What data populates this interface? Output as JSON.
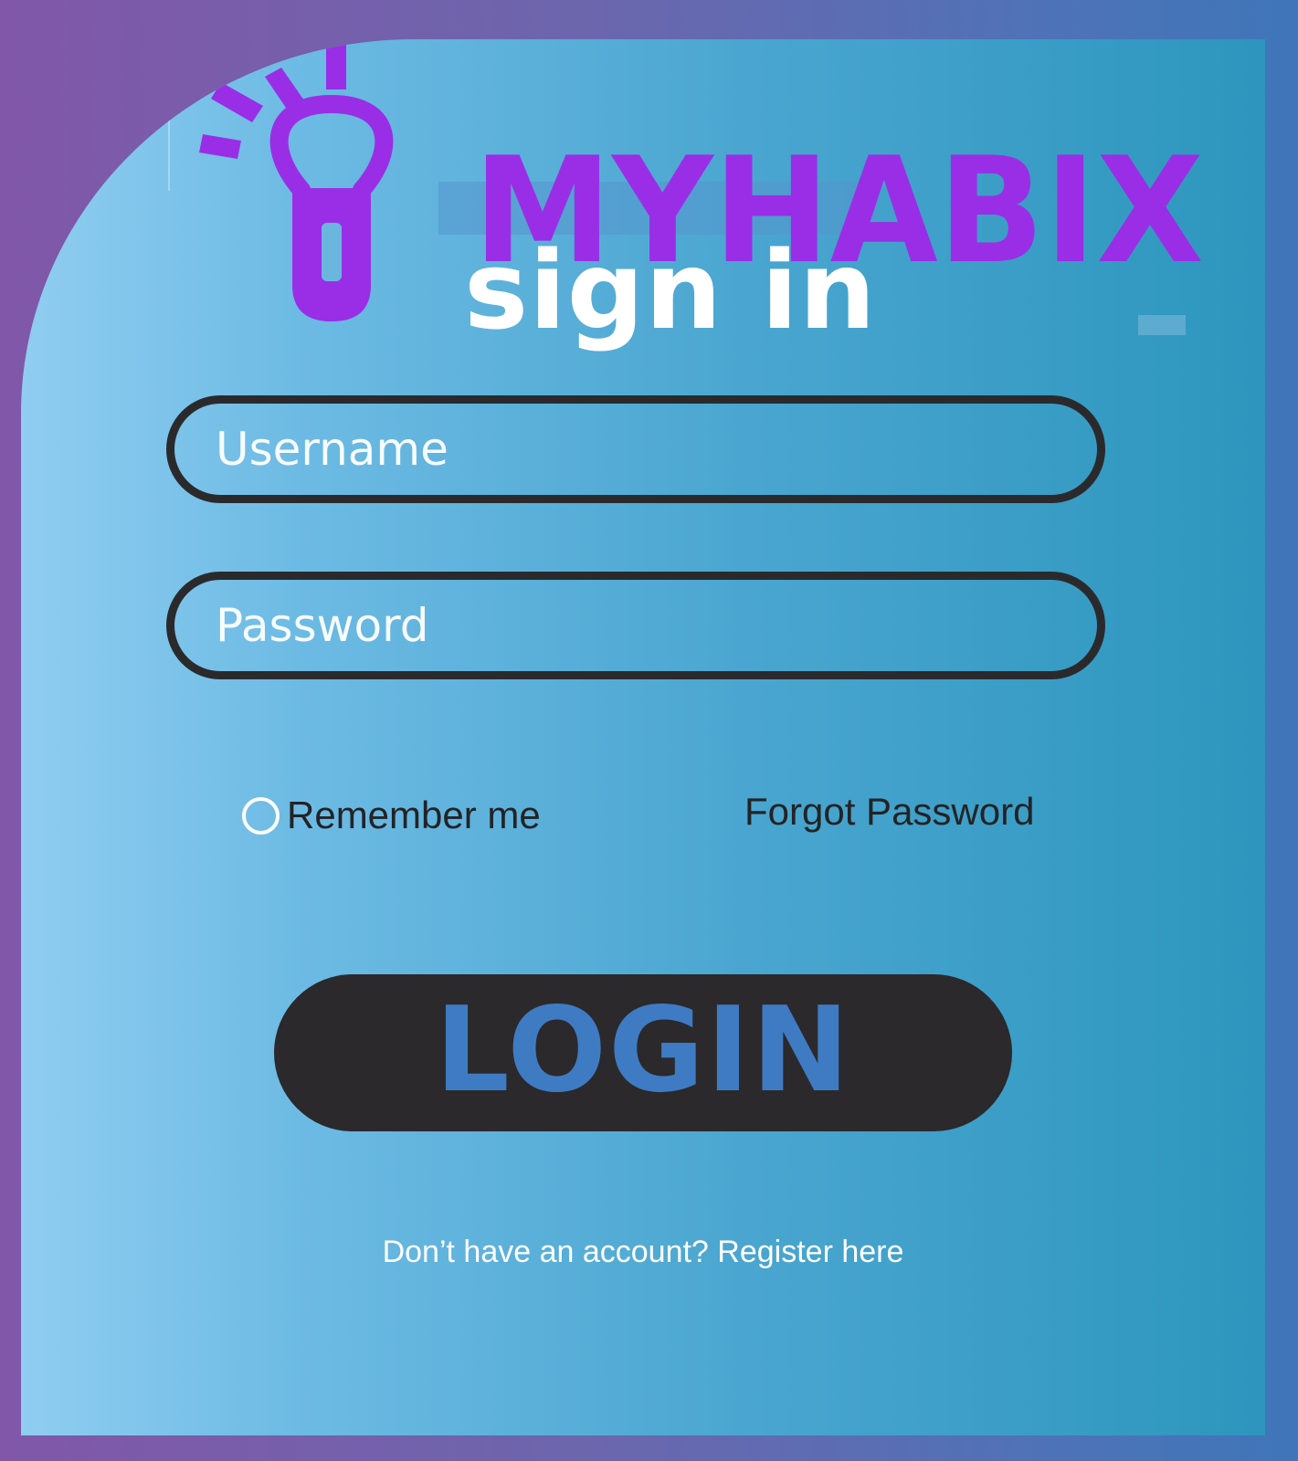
{
  "brand": {
    "name": "MYHABIX",
    "color": "#9a2ee6"
  },
  "heading": "sign in",
  "form": {
    "username_placeholder": "Username",
    "password_placeholder": "Password",
    "remember_label": "Remember me",
    "forgot_label": "Forgot Password",
    "login_label": "LOGIN"
  },
  "register_text": "Don’t have an account? Register here",
  "icons": {
    "logo": "lightbulb-icon",
    "remember": "radio-circle-icon"
  },
  "colors": {
    "background_outer": "#6c66ad",
    "panel": "#4aa6d0",
    "field_border": "#2a2a2d",
    "login_button": "#2b292c",
    "login_text": "#3f7bc3",
    "text_dark": "#232326",
    "text_light": "#ffffff"
  }
}
